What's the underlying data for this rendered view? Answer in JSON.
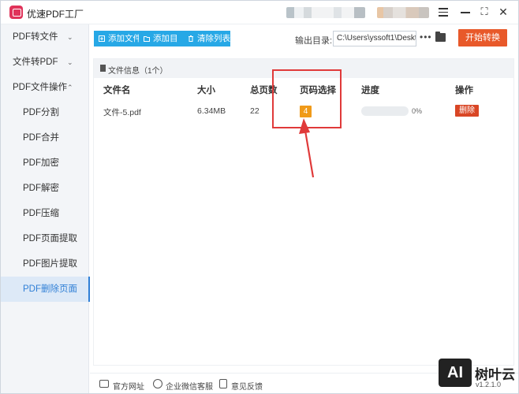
{
  "app": {
    "title": "优速PDF工厂"
  },
  "window_controls": {
    "maximize": "⛶",
    "close": "✕"
  },
  "sidebar": {
    "items": [
      {
        "label": "PDF转文件",
        "chevron": "⌄"
      },
      {
        "label": "文件转PDF",
        "chevron": "⌄"
      },
      {
        "label": "PDF文件操作",
        "chevron": "⌃"
      },
      {
        "label": "PDF分割"
      },
      {
        "label": "PDF合并"
      },
      {
        "label": "PDF加密"
      },
      {
        "label": "PDF解密"
      },
      {
        "label": "PDF压缩"
      },
      {
        "label": "PDF页面提取"
      },
      {
        "label": "PDF图片提取"
      },
      {
        "label": "PDF删除页面",
        "active": true
      }
    ]
  },
  "toolbar": {
    "add_file": "添加文件",
    "add_dir": "添加目录",
    "clear_list": "清除列表",
    "output_label": "输出目录:",
    "output_path": "C:\\Users\\yssoft1\\Deskt",
    "more": "•••",
    "start": "开始转换"
  },
  "panel": {
    "title": "文件信息（1个）",
    "columns": [
      "文件名",
      "大小",
      "总页数",
      "页码选择",
      "进度",
      "操作"
    ],
    "rows": [
      {
        "name": "文件-5.pdf",
        "size": "6.34MB",
        "pages": "22",
        "page_select": "4",
        "progress": "0%",
        "progress_value": 0,
        "action": "删除"
      }
    ]
  },
  "footer": {
    "website": "官方网址",
    "wechat": "企业微信客服",
    "feedback": "意见反馈"
  },
  "watermark": {
    "logo": "AI",
    "name": "树叶云",
    "version": "v1.2.1.0"
  },
  "colors": {
    "accent": "#27a8e6",
    "start": "#e8592a",
    "badge": "#f09a19",
    "delete": "#d94625",
    "highlight": "#e03a3a"
  }
}
